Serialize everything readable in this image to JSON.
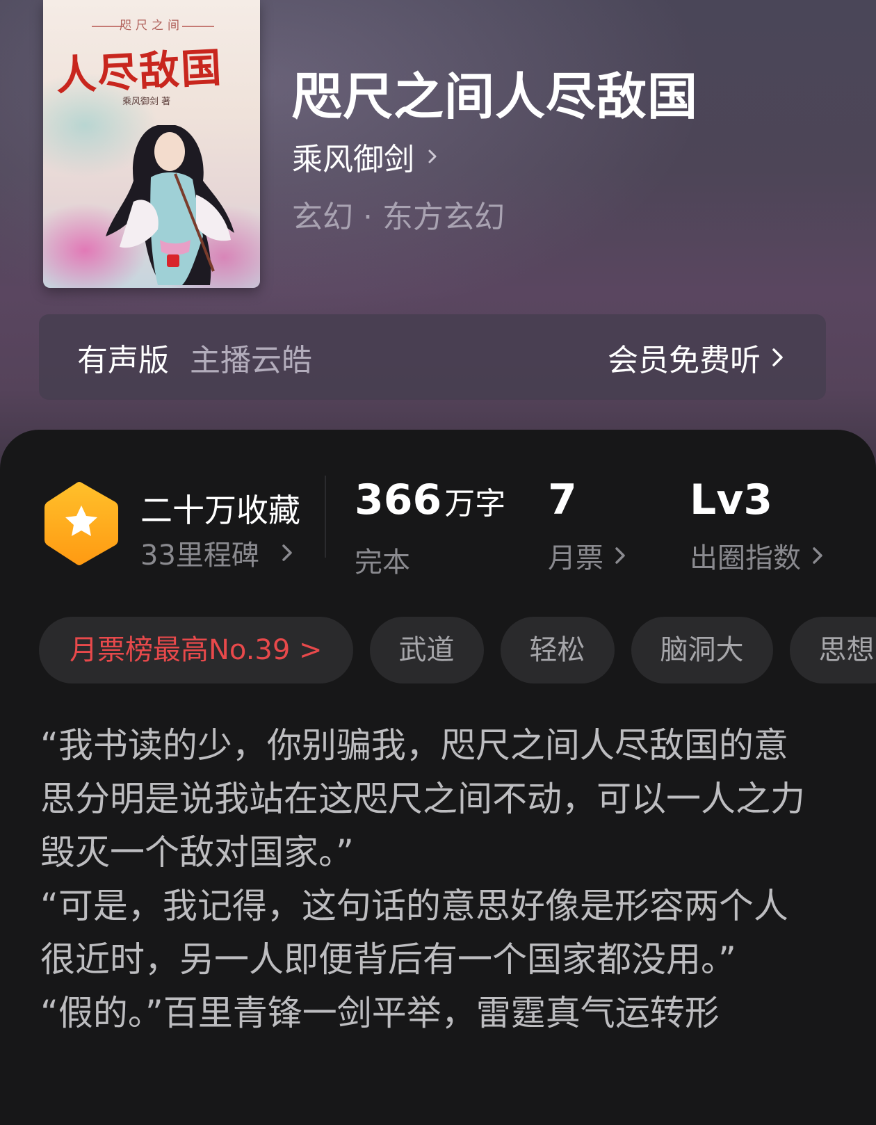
{
  "book": {
    "cover": {
      "small_title": "咫尺之间",
      "title": "人尽敌国",
      "author_line": "乘风御剑 著"
    },
    "title": "咫尺之间人尽敌国",
    "author": "乘风御剑",
    "category": "玄幻 · 东方玄幻"
  },
  "audio": {
    "label": "有声版",
    "anchor": "主播云皓",
    "cta": "会员免费听"
  },
  "stats": {
    "favorites": "二十万收藏",
    "milestones": "33里程碑",
    "word_count": "366",
    "word_unit": "万字",
    "status": "完本",
    "monthly_tickets": "7",
    "monthly_label": "月票",
    "level": "Lv3",
    "level_label": "出圈指数"
  },
  "tags": [
    "月票榜最高No.39 >",
    "武道",
    "轻松",
    "脑洞大",
    "思想"
  ],
  "excerpt": [
    "“我书读的少，你别骗我，咫尺之间人尽敌国的意思分明是说我站在这咫尺之间不动，可以一人之力毁灭一个敌对国家。”",
    "“可是，我记得，这句话的意思好像是形容两个人很近时，另一人即便背后有一个国家都没用。”",
    "“假的。”百里青锋一剑平举，雷霆真气运转形"
  ],
  "colors": {
    "accent_red": "#e8494b",
    "badge_orange": "#ffb21f",
    "sheet_bg": "#171718"
  }
}
